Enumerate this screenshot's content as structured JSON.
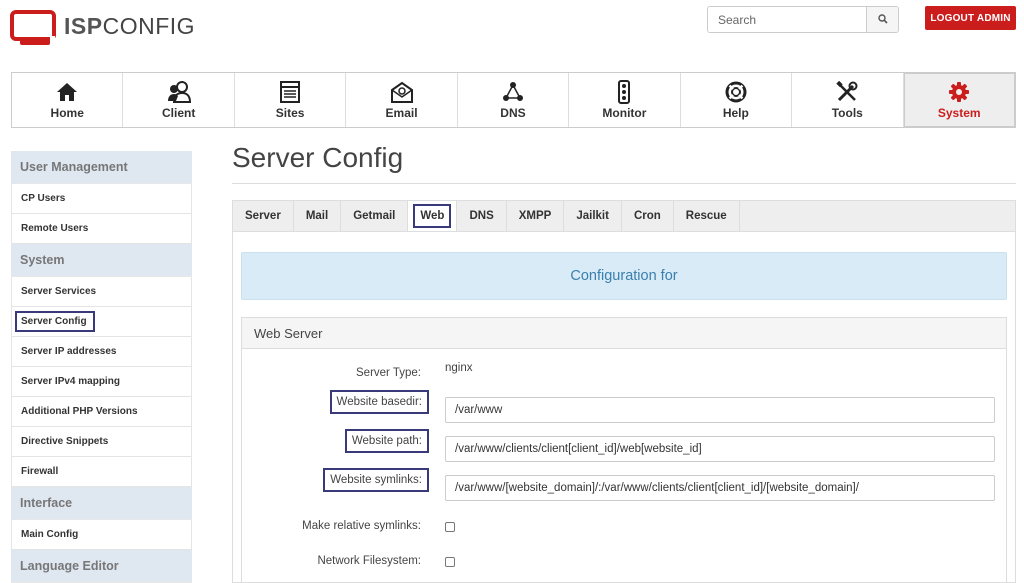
{
  "header": {
    "logo_bold": "ISP",
    "logo_light": "CONFIG",
    "search_placeholder": "Search",
    "logout_label": "LOGOUT ADMIN"
  },
  "nav": [
    {
      "label": "Home",
      "icon": "home-icon"
    },
    {
      "label": "Client",
      "icon": "users-icon"
    },
    {
      "label": "Sites",
      "icon": "browser-window-icon"
    },
    {
      "label": "Email",
      "icon": "envelope-icon"
    },
    {
      "label": "DNS",
      "icon": "network-nodes-icon"
    },
    {
      "label": "Monitor",
      "icon": "traffic-light-icon"
    },
    {
      "label": "Help",
      "icon": "lifebuoy-icon"
    },
    {
      "label": "Tools",
      "icon": "tools-icon"
    },
    {
      "label": "System",
      "icon": "gear-icon"
    }
  ],
  "sidebar": {
    "groups": [
      {
        "title": "User Management",
        "items": [
          "CP Users",
          "Remote Users"
        ]
      },
      {
        "title": "System",
        "items": [
          "Server Services",
          "Server Config",
          "Server IP addresses",
          "Server IPv4 mapping",
          "Additional PHP Versions",
          "Directive Snippets",
          "Firewall"
        ]
      },
      {
        "title": "Interface",
        "items": [
          "Main Config"
        ]
      },
      {
        "title": "Language Editor",
        "items": []
      }
    ]
  },
  "page": {
    "title": "Server Config",
    "tabs": [
      "Server",
      "Mail",
      "Getmail",
      "Web",
      "DNS",
      "XMPP",
      "Jailkit",
      "Cron",
      "Rescue"
    ],
    "active_tab": "Web",
    "banner": "Configuration for",
    "section_title": "Web Server",
    "fields": {
      "server_type_label": "Server Type:",
      "server_type_value": "nginx",
      "basedir_label": "Website basedir:",
      "basedir_value": "/var/www",
      "path_label": "Website path:",
      "path_value": "/var/www/clients/client[client_id]/web[website_id]",
      "symlinks_label": "Website symlinks:",
      "symlinks_value": "/var/www/[website_domain]/:/var/www/clients/client[client_id]/[website_domain]/",
      "relative_label": "Make relative symlinks:",
      "network_fs_label": "Network Filesystem:"
    }
  },
  "colors": {
    "brand_red": "#cc1d1d",
    "banner_bg": "#d9ebf6",
    "banner_text": "#3a7fae",
    "sidebar_head_bg": "#dfe7f1",
    "highlight_box": "#3a3a7a"
  }
}
